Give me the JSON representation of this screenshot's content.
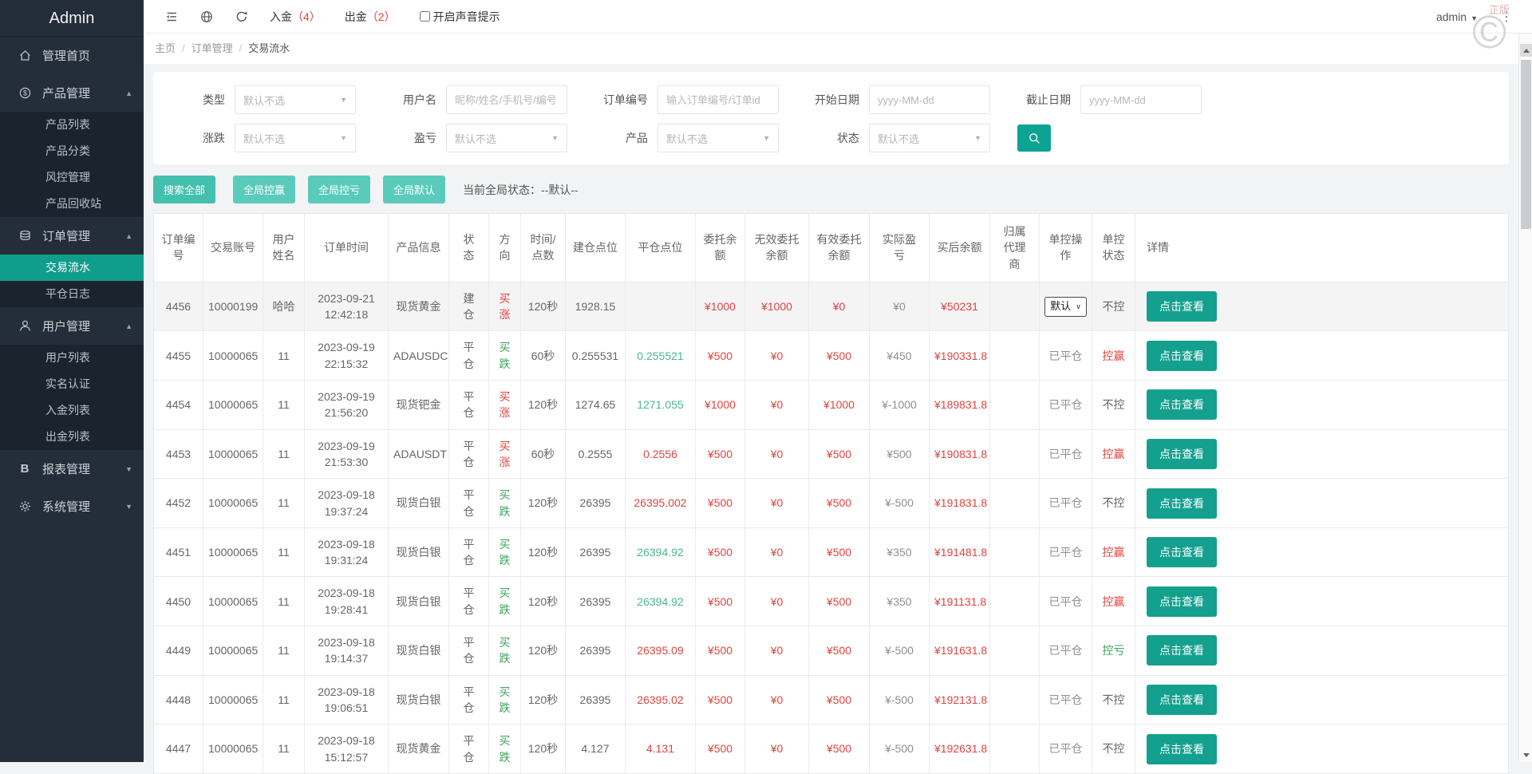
{
  "colors": {
    "teal": "#14a08e",
    "teal_mid": "#44c0ae",
    "teal_light": "#5acbbb",
    "sidebar_active": "#0f9d8c",
    "red": "#e04440",
    "green": "#3ea35f",
    "green_light": "#49b789"
  },
  "icons": {
    "caret_down": "▼",
    "arrow_up": "▲",
    "arrow_down": "▼",
    "select_caret": "∨",
    "dots": "⋮"
  },
  "sidebar": {
    "title": "Admin",
    "menu": [
      {
        "id": "home",
        "icon": "home-icon",
        "label": "管理首页",
        "arrow": "",
        "children": []
      },
      {
        "id": "product",
        "icon": "product-icon",
        "label": "产品管理",
        "arrow": "up",
        "children": [
          {
            "id": "product-list",
            "label": "产品列表"
          },
          {
            "id": "product-category",
            "label": "产品分类"
          },
          {
            "id": "risk-manage",
            "label": "风控管理"
          },
          {
            "id": "product-recycle",
            "label": "产品回收站"
          }
        ]
      },
      {
        "id": "order",
        "icon": "order-icon",
        "label": "订单管理",
        "arrow": "up",
        "children": [
          {
            "id": "trade-flow",
            "label": "交易流水",
            "active": true
          },
          {
            "id": "close-log",
            "label": "平仓日志"
          }
        ]
      },
      {
        "id": "user",
        "icon": "user-icon",
        "label": "用户管理",
        "arrow": "up",
        "children": [
          {
            "id": "user-list",
            "label": "用户列表"
          },
          {
            "id": "realname-auth",
            "label": "实名认证"
          },
          {
            "id": "deposit-list",
            "label": "入金列表"
          },
          {
            "id": "withdraw-list",
            "label": "出金列表"
          }
        ]
      },
      {
        "id": "report",
        "icon": "report-icon",
        "label": "报表管理",
        "arrow": "down",
        "children": []
      },
      {
        "id": "system",
        "icon": "system-icon",
        "label": "系统管理",
        "arrow": "down",
        "children": []
      }
    ]
  },
  "topbar": {
    "deposit_label": "入金",
    "deposit_count": "（4）",
    "withdraw_label": "出金",
    "withdraw_count": "（2）",
    "sound_label": "开启声音提示",
    "username": "admin",
    "watermark_text": "正版",
    "watermark_symbol": "©"
  },
  "breadcrumb": {
    "items": [
      "主页",
      "订单管理",
      "交易流水"
    ],
    "separator": "/"
  },
  "filters": {
    "row1": [
      {
        "label": "类型",
        "type": "select",
        "value": "默认不选"
      },
      {
        "label": "用户名",
        "type": "input",
        "placeholder": "昵称/姓名/手机号/编号"
      },
      {
        "label": "订单编号",
        "type": "input",
        "placeholder": "输入订单编号/订单id"
      },
      {
        "label": "开始日期",
        "type": "input",
        "placeholder": "yyyy-MM-dd"
      },
      {
        "label": "截止日期",
        "type": "input",
        "placeholder": "yyyy-MM-dd"
      }
    ],
    "row2": [
      {
        "label": "涨跌",
        "type": "select",
        "value": "默认不选"
      },
      {
        "label": "盈亏",
        "type": "select",
        "value": "默认不选"
      },
      {
        "label": "产品",
        "type": "select",
        "value": "默认不选"
      },
      {
        "label": "状态",
        "type": "select",
        "value": "默认不选"
      },
      {
        "label": "",
        "type": "search"
      }
    ]
  },
  "actions": {
    "buttons": [
      {
        "id": "search-all",
        "label": "搜索全部",
        "variant": "mid"
      },
      {
        "id": "global-win",
        "label": "全局控赢",
        "variant": "light"
      },
      {
        "id": "global-lose",
        "label": "全局控亏",
        "variant": "light"
      },
      {
        "id": "global-default",
        "label": "全局默认",
        "variant": "light"
      }
    ],
    "status_text": "当前全局状态：--默认--"
  },
  "table": {
    "headers": [
      "订单编\n号",
      "交易账号",
      "用户\n姓名",
      "订单时间",
      "产品信息",
      "状\n态",
      "方\n向",
      "时间/\n点数",
      "建仓点位",
      "平仓点位",
      "委托余\n额",
      "无效委托\n余额",
      "有效委托\n余额",
      "实际盈\n亏",
      "买后余额",
      "归属\n代理\n商",
      "单控操\n作",
      "单控\n状态",
      "详情"
    ],
    "select_label": "默认",
    "closed_label": "已平仓",
    "detail_label": "点击查看",
    "rows": [
      {
        "id": "4456",
        "account": "10000199",
        "name": "哈哈",
        "time": "2023-09-21\n12:42:18",
        "product": "现货黄金",
        "status": "建\n仓",
        "dir": "买\n涨",
        "dir_color": "red",
        "duration": "120秒",
        "open": "1928.15",
        "close": "",
        "close_color": "",
        "entrust": "¥1000",
        "invalid": "¥1000",
        "valid": "¥0",
        "profit": "¥0",
        "after": "¥50231",
        "agent": "",
        "op": "select",
        "ctrl": "不控",
        "ctrl_color": "gray",
        "highlight": true
      },
      {
        "id": "4455",
        "account": "10000065",
        "name": "11",
        "time": "2023-09-19\n22:15:32",
        "product": "ADAUSDC",
        "status": "平\n仓",
        "dir": "买\n跌",
        "dir_color": "green",
        "duration": "60秒",
        "open": "0.255531",
        "close": "0.255521",
        "close_color": "green",
        "entrust": "¥500",
        "invalid": "¥0",
        "valid": "¥500",
        "profit": "¥450",
        "after": "¥190331.8",
        "agent": "",
        "op": "closed",
        "ctrl": "控赢",
        "ctrl_color": "red",
        "highlight": false
      },
      {
        "id": "4454",
        "account": "10000065",
        "name": "11",
        "time": "2023-09-19\n21:56:20",
        "product": "现货钯金",
        "status": "平\n仓",
        "dir": "买\n涨",
        "dir_color": "red",
        "duration": "120秒",
        "open": "1274.65",
        "close": "1271.055",
        "close_color": "green",
        "entrust": "¥1000",
        "invalid": "¥0",
        "valid": "¥1000",
        "profit": "¥-1000",
        "after": "¥189831.8",
        "agent": "",
        "op": "closed",
        "ctrl": "不控",
        "ctrl_color": "gray",
        "highlight": false
      },
      {
        "id": "4453",
        "account": "10000065",
        "name": "11",
        "time": "2023-09-19\n21:53:30",
        "product": "ADAUSDT",
        "status": "平\n仓",
        "dir": "买\n涨",
        "dir_color": "red",
        "duration": "60秒",
        "open": "0.2555",
        "close": "0.2556",
        "close_color": "red",
        "entrust": "¥500",
        "invalid": "¥0",
        "valid": "¥500",
        "profit": "¥500",
        "after": "¥190831.8",
        "agent": "",
        "op": "closed",
        "ctrl": "控赢",
        "ctrl_color": "red",
        "highlight": false
      },
      {
        "id": "4452",
        "account": "10000065",
        "name": "11",
        "time": "2023-09-18\n19:37:24",
        "product": "现货白银",
        "status": "平\n仓",
        "dir": "买\n跌",
        "dir_color": "green",
        "duration": "120秒",
        "open": "26395",
        "close": "26395.002",
        "close_color": "red",
        "entrust": "¥500",
        "invalid": "¥0",
        "valid": "¥500",
        "profit": "¥-500",
        "after": "¥191831.8",
        "agent": "",
        "op": "closed",
        "ctrl": "不控",
        "ctrl_color": "gray",
        "highlight": false
      },
      {
        "id": "4451",
        "account": "10000065",
        "name": "11",
        "time": "2023-09-18\n19:31:24",
        "product": "现货白银",
        "status": "平\n仓",
        "dir": "买\n跌",
        "dir_color": "green",
        "duration": "120秒",
        "open": "26395",
        "close": "26394.92",
        "close_color": "green",
        "entrust": "¥500",
        "invalid": "¥0",
        "valid": "¥500",
        "profit": "¥350",
        "after": "¥191481.8",
        "agent": "",
        "op": "closed",
        "ctrl": "控赢",
        "ctrl_color": "red",
        "highlight": false
      },
      {
        "id": "4450",
        "account": "10000065",
        "name": "11",
        "time": "2023-09-18\n19:28:41",
        "product": "现货白银",
        "status": "平\n仓",
        "dir": "买\n跌",
        "dir_color": "green",
        "duration": "120秒",
        "open": "26395",
        "close": "26394.92",
        "close_color": "green",
        "entrust": "¥500",
        "invalid": "¥0",
        "valid": "¥500",
        "profit": "¥350",
        "after": "¥191131.8",
        "agent": "",
        "op": "closed",
        "ctrl": "控赢",
        "ctrl_color": "red",
        "highlight": false
      },
      {
        "id": "4449",
        "account": "10000065",
        "name": "11",
        "time": "2023-09-18\n19:14:37",
        "product": "现货白银",
        "status": "平\n仓",
        "dir": "买\n跌",
        "dir_color": "green",
        "duration": "120秒",
        "open": "26395",
        "close": "26395.09",
        "close_color": "red",
        "entrust": "¥500",
        "invalid": "¥0",
        "valid": "¥500",
        "profit": "¥-500",
        "after": "¥191631.8",
        "agent": "",
        "op": "closed",
        "ctrl": "控亏",
        "ctrl_color": "green",
        "highlight": false
      },
      {
        "id": "4448",
        "account": "10000065",
        "name": "11",
        "time": "2023-09-18\n19:06:51",
        "product": "现货白银",
        "status": "平\n仓",
        "dir": "买\n跌",
        "dir_color": "green",
        "duration": "120秒",
        "open": "26395",
        "close": "26395.02",
        "close_color": "red",
        "entrust": "¥500",
        "invalid": "¥0",
        "valid": "¥500",
        "profit": "¥-500",
        "after": "¥192131.8",
        "agent": "",
        "op": "closed",
        "ctrl": "不控",
        "ctrl_color": "gray",
        "highlight": false
      },
      {
        "id": "4447",
        "account": "10000065",
        "name": "11",
        "time": "2023-09-18\n15:12:57",
        "product": "现货黄金",
        "status": "平\n仓",
        "dir": "买\n跌",
        "dir_color": "green",
        "duration": "120秒",
        "open": "4.127",
        "close": "4.131",
        "close_color": "red",
        "entrust": "¥500",
        "invalid": "¥0",
        "valid": "¥500",
        "profit": "¥-500",
        "after": "¥192631.8",
        "agent": "",
        "op": "closed",
        "ctrl": "不控",
        "ctrl_color": "gray",
        "highlight": false
      }
    ]
  }
}
